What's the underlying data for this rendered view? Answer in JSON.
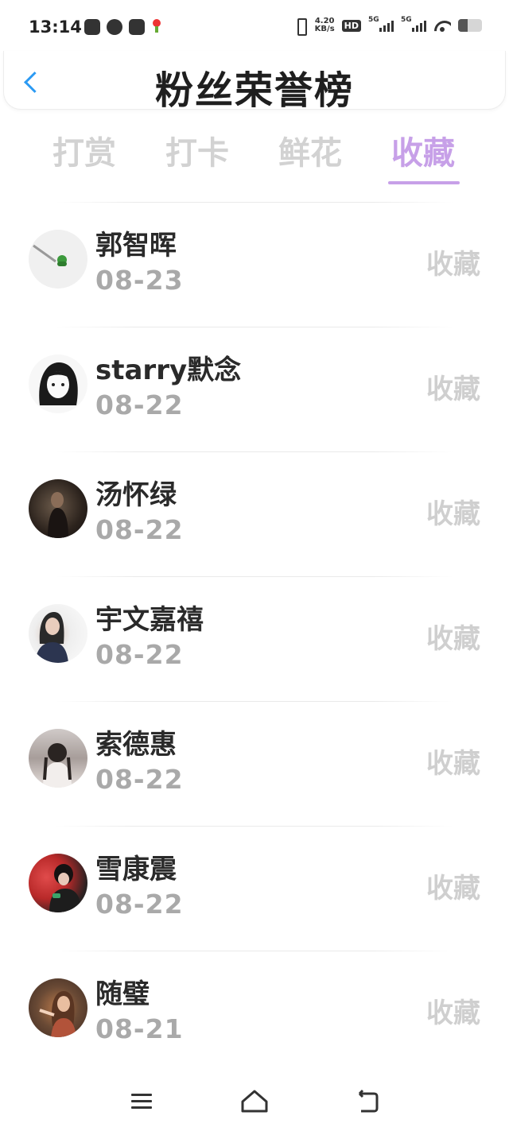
{
  "status_bar": {
    "time": "13:14",
    "net_speed_value": "4.20",
    "net_speed_unit": "KB/s",
    "hd_label": "HD",
    "sim1_label": "5G",
    "sim2_label": "5G",
    "battery_level": 0.4
  },
  "header": {
    "title": "粉丝荣誉榜",
    "back_icon": "chevron-left-icon"
  },
  "tabs": [
    {
      "label": "打赏",
      "active": false
    },
    {
      "label": "打卡",
      "active": false
    },
    {
      "label": "鲜花",
      "active": false
    },
    {
      "label": "收藏",
      "active": true
    }
  ],
  "colors": {
    "accent": "#c7a0e8",
    "back_arrow": "#2b9af3",
    "inactive_tab": "#d2d2d2"
  },
  "list": [
    {
      "name": "郭智晖",
      "date": "08-23",
      "action": "收藏"
    },
    {
      "name": "starry默念",
      "date": "08-22",
      "action": "收藏"
    },
    {
      "name": "汤怀绿",
      "date": "08-22",
      "action": "收藏"
    },
    {
      "name": "宇文嘉禧",
      "date": "08-22",
      "action": "收藏"
    },
    {
      "name": "索德惠",
      "date": "08-22",
      "action": "收藏"
    },
    {
      "name": "雪康震",
      "date": "08-22",
      "action": "收藏"
    },
    {
      "name": "随璧",
      "date": "08-21",
      "action": "收藏"
    }
  ],
  "bottom_nav": {
    "icons": [
      "menu-icon",
      "home-icon",
      "back-icon"
    ]
  }
}
